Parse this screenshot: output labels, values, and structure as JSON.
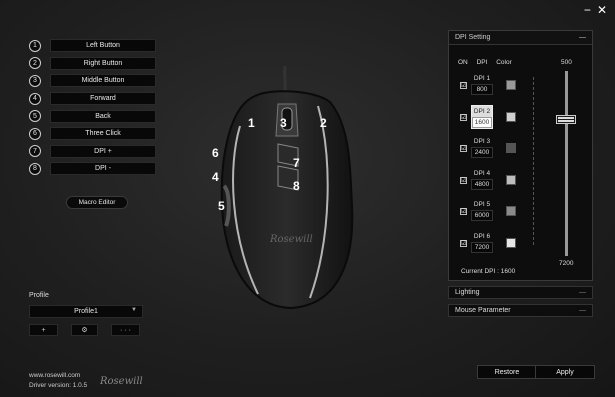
{
  "window": {
    "minimize": "−",
    "close": "✕"
  },
  "buttons": [
    {
      "num": "1",
      "label": "Left Button"
    },
    {
      "num": "2",
      "label": "Right Button"
    },
    {
      "num": "3",
      "label": "Middle Button"
    },
    {
      "num": "4",
      "label": "Forward"
    },
    {
      "num": "5",
      "label": "Back"
    },
    {
      "num": "6",
      "label": "Three Click"
    },
    {
      "num": "7",
      "label": "DPI +"
    },
    {
      "num": "8",
      "label": "DPI -"
    }
  ],
  "macro_editor": "Macro Editor",
  "profile": {
    "label": "Profile",
    "selected": "Profile1",
    "add": "+",
    "settings_icon": "⚙",
    "more": "· · ·"
  },
  "mouse_labels": [
    "1",
    "2",
    "3",
    "4",
    "5",
    "6",
    "7",
    "8"
  ],
  "dpi": {
    "title": "DPI Setting",
    "collapse": "—",
    "col_on": "ON",
    "col_dpi": "DPI",
    "col_color": "Color",
    "max_label": "500",
    "min_label": "7200",
    "rows": [
      {
        "name": "DPI 1",
        "value": "800",
        "color": "#9a9a9a"
      },
      {
        "name": "DPI 2",
        "value": "1600",
        "color": "#d0d0d0"
      },
      {
        "name": "DPI 3",
        "value": "2400",
        "color": "#555555"
      },
      {
        "name": "DPI 4",
        "value": "4800",
        "color": "#bdbdbd"
      },
      {
        "name": "DPI 5",
        "value": "6000",
        "color": "#8a8a8a"
      },
      {
        "name": "DPI 6",
        "value": "7200",
        "color": "#e6e6e6"
      }
    ],
    "check_mark": "☑",
    "current_label": "Current DPI :",
    "current_value": "1600",
    "slider_fraction": 0.26
  },
  "lighting": {
    "label": "Lighting",
    "dash": "—"
  },
  "mouse_parameter": {
    "label": "Mouse Parameter",
    "dash": "—"
  },
  "footer": {
    "url": "www.rosewill.com",
    "driver": "Driver version: 1.0.5",
    "logo": "Rosewill"
  },
  "actions": {
    "restore": "Restore",
    "apply": "Apply"
  }
}
